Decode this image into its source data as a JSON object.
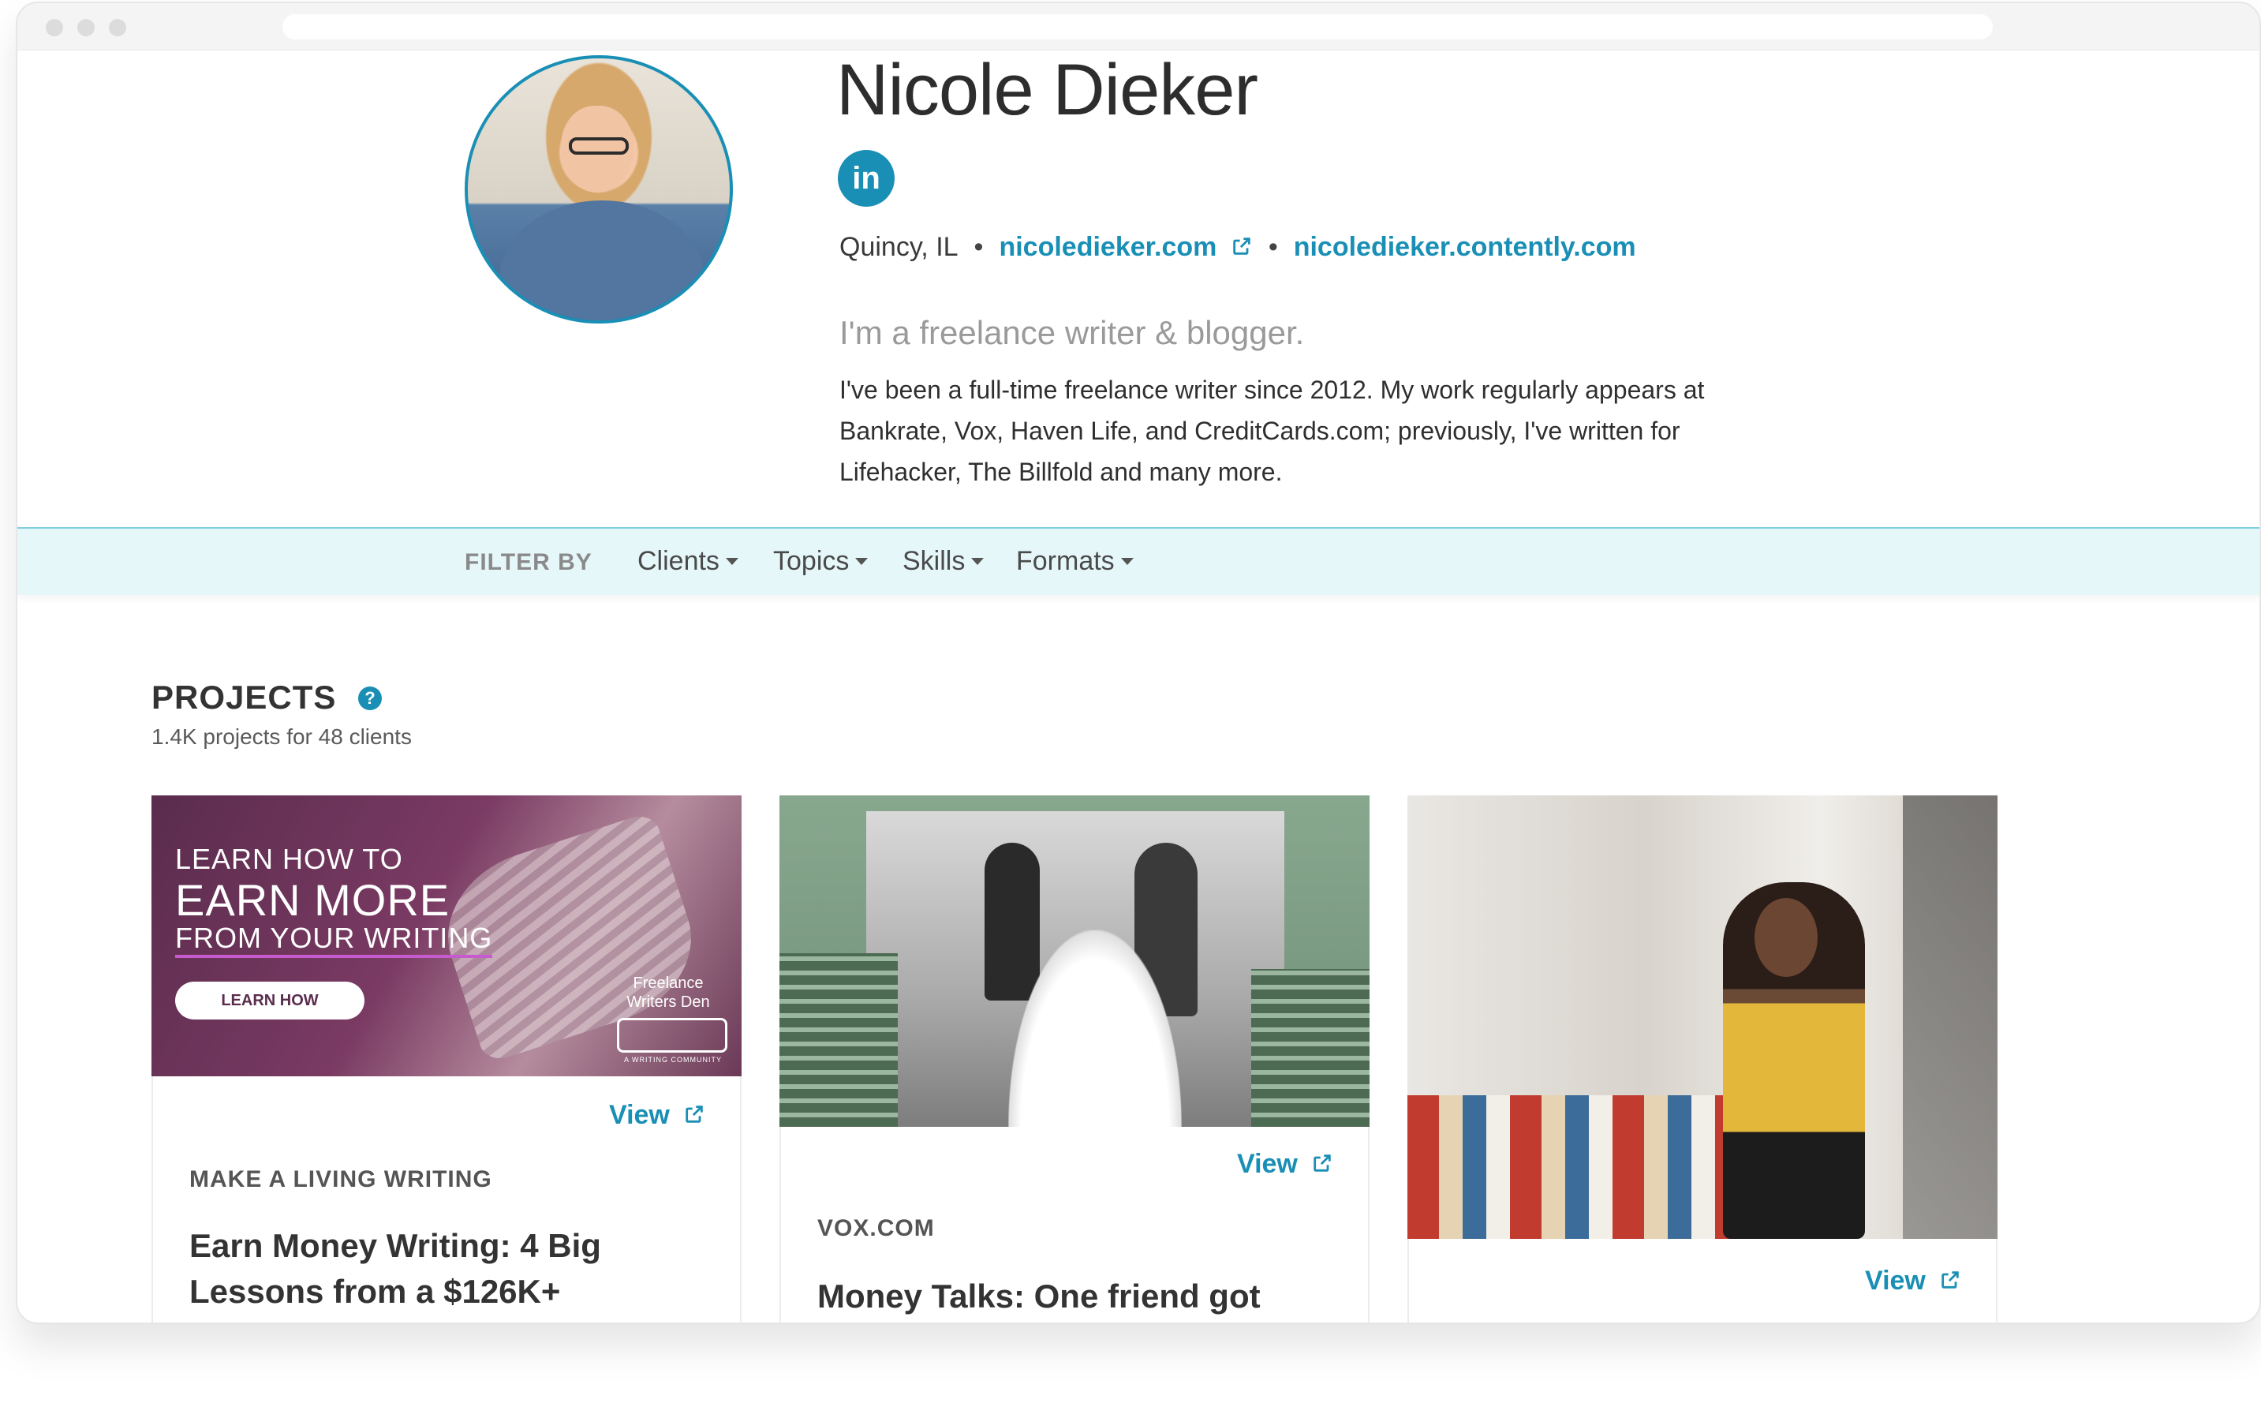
{
  "profile": {
    "name": "Nicole Dieker",
    "linkedin_label": "in",
    "location": "Quincy, IL",
    "website": "nicoledieker.com",
    "portfolio": "nicoledieker.contently.com",
    "separator": "•",
    "tagline": "I'm a freelance writer & blogger.",
    "bio": "I've been a full-time freelance writer since 2012. My work regularly appears at Bankrate, Vox, Haven Life, and CreditCards.com; previously, I've written for Lifehacker, The Billfold and many more."
  },
  "filter": {
    "label": "FILTER BY",
    "items": [
      "Clients",
      "Topics",
      "Skills",
      "Formats"
    ]
  },
  "projects": {
    "title": "PROJECTS",
    "help": "?",
    "subtitle": "1.4K projects for 48 clients",
    "cards": [
      {
        "view_label": "View",
        "client": "MAKE A LIVING WRITING",
        "title": "Earn Money Writing: 4 Big Lessons from a $126K+",
        "thumb": {
          "line1": "LEARN HOW TO",
          "line2": "EARN MORE",
          "line3": "FROM YOUR WRITING",
          "button": "LEARN HOW",
          "brand": "Freelance Writers Den",
          "brand_sub": "A WRITING COMMUNITY"
        }
      },
      {
        "view_label": "View",
        "client": "VOX.COM",
        "title": "Money Talks: One friend got"
      },
      {
        "view_label": "View"
      }
    ]
  },
  "colors": {
    "accent": "#1a8fb5",
    "filter_bg": "#e6f7fa"
  },
  "icons": {
    "external_link": "external-link-icon",
    "help": "help-icon",
    "linkedin": "linkedin-icon"
  }
}
